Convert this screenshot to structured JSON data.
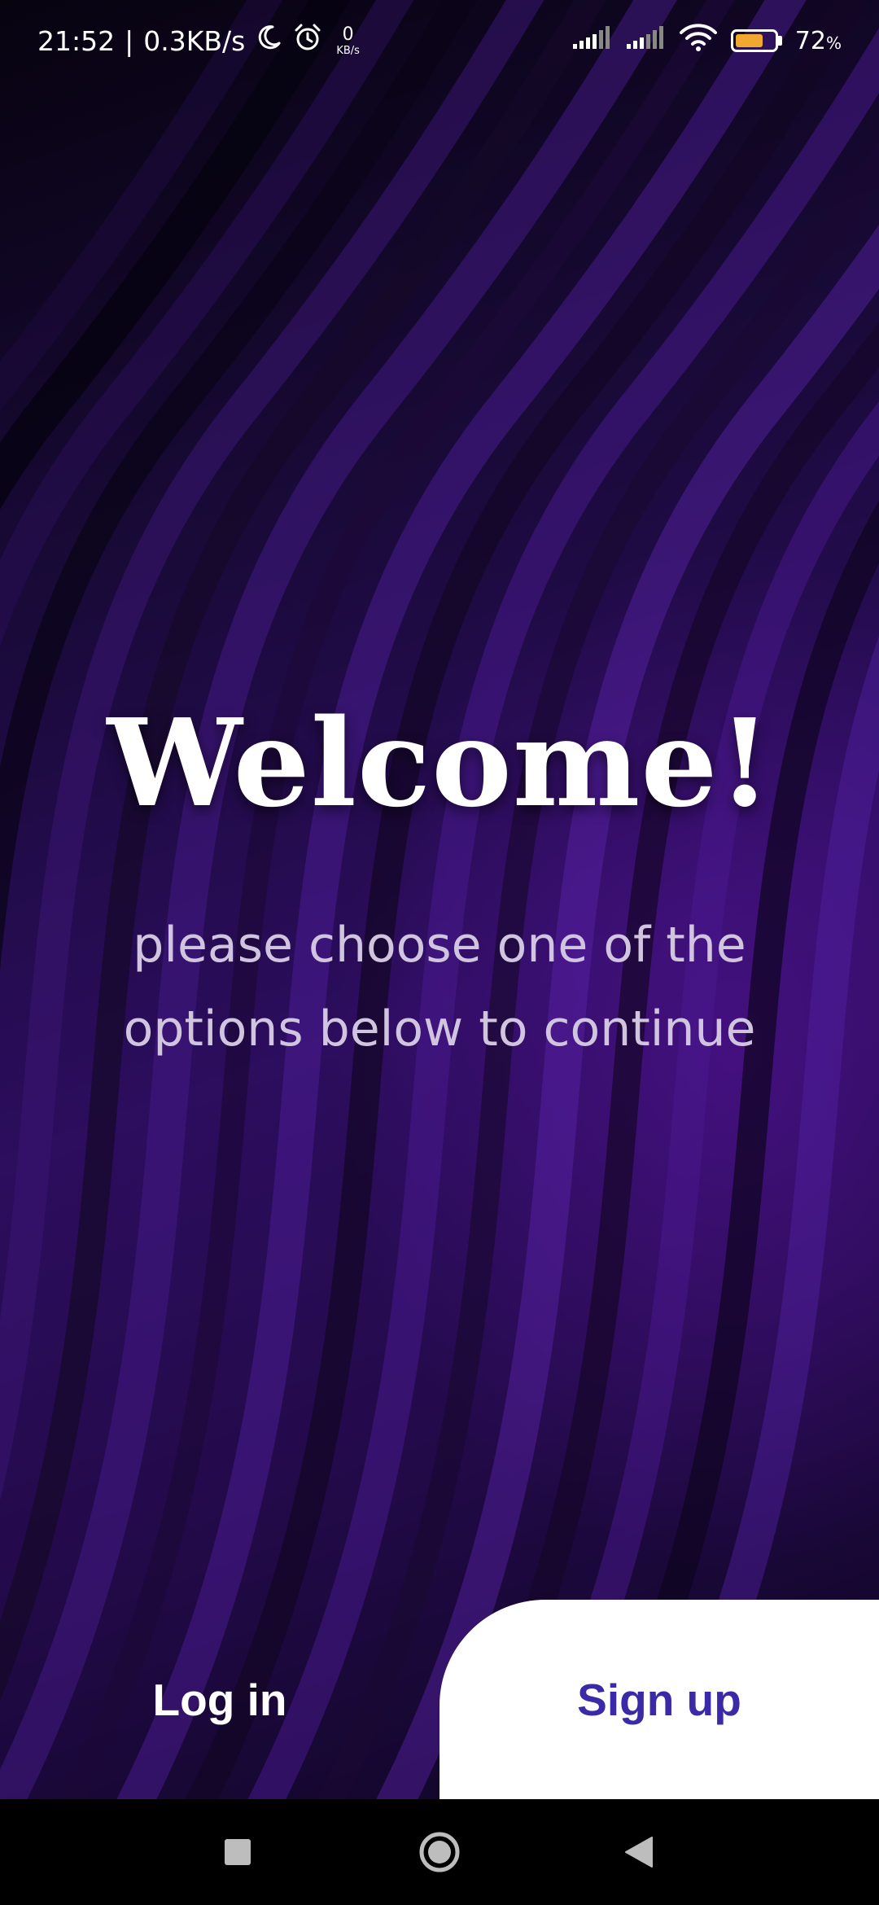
{
  "status_bar": {
    "time": "21:52",
    "separator": "|",
    "network_speed": "0.3KB/s",
    "secondary_speed_value": "0",
    "secondary_speed_unit": "KB/s",
    "battery_percent": "72",
    "battery_percent_sign": "%",
    "battery_level": 0.72,
    "battery_color": "#f0a830",
    "icons": [
      "moon-icon",
      "alarm-icon",
      "signal-icon",
      "signal-icon",
      "wifi-icon",
      "battery-icon"
    ]
  },
  "welcome": {
    "title": "Welcome!",
    "subtitle_line1": "please choose one of the",
    "subtitle_line2": "options below to continue"
  },
  "actions": {
    "login_label": "Log in",
    "signup_label": "Sign up"
  },
  "colors": {
    "signup_text": "#3a2aa8",
    "subtitle_text": "#d0c4de",
    "background_accent": "#2c0d5e"
  },
  "navigation": {
    "icons": [
      "recents-square-icon",
      "home-circle-icon",
      "back-triangle-icon"
    ]
  }
}
